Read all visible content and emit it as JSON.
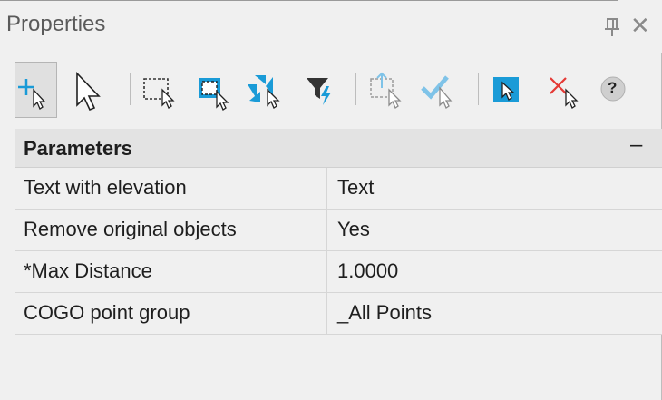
{
  "panel": {
    "title": "Properties",
    "pin_icon": "pin-icon",
    "close_label": "✕"
  },
  "toolbar": {
    "buttons": [
      {
        "name": "add-selection-icon"
      },
      {
        "name": "select-cursor-icon"
      },
      {
        "name": "window-select-icon"
      },
      {
        "name": "crossing-select-icon"
      },
      {
        "name": "select-similar-icon"
      },
      {
        "name": "filter-select-icon"
      },
      {
        "name": "pick-to-add-icon"
      },
      {
        "name": "confirm-select-icon"
      },
      {
        "name": "quick-select-icon"
      },
      {
        "name": "remove-selection-icon"
      },
      {
        "name": "help-icon"
      }
    ],
    "help_label": "?"
  },
  "parameters": {
    "heading": "Parameters",
    "toggle": "–",
    "rows": [
      {
        "name": "Text with elevation",
        "value": "Text"
      },
      {
        "name": "Remove original objects",
        "value": "Yes"
      },
      {
        "name": "*Max Distance",
        "value": "1.0000"
      },
      {
        "name": "COGO point group",
        "value": "_All Points"
      }
    ]
  },
  "colors": {
    "background": "#f0f0f0",
    "accent_blue": "#1a9bd7",
    "red_x": "#e53935"
  }
}
